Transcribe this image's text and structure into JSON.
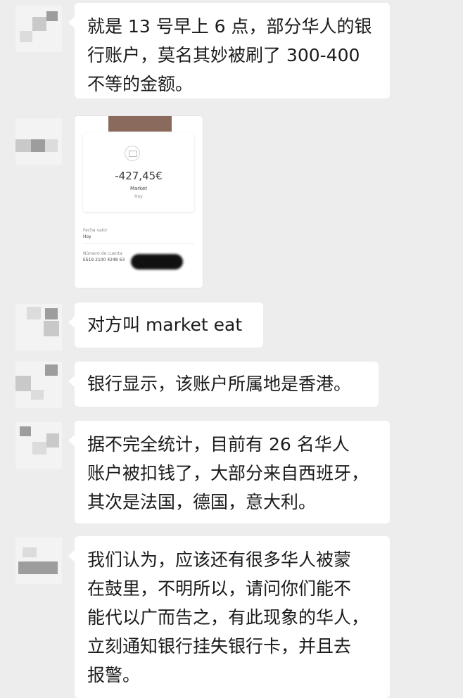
{
  "messages": [
    {
      "type": "text",
      "lines": [
        "就是 13 号早上 6 点，部分华人的银",
        "行账户，莫名其妙被刷了 300-400",
        "不等的金额。"
      ]
    },
    {
      "type": "image",
      "amount": "-427,45€",
      "merchant": "Market",
      "date": "Hoy",
      "field1_label": "Fecha valor",
      "field1_value": "Hoy",
      "field2_label": "Número de cuenta",
      "field2_value": "ES19 2100 4248 63"
    },
    {
      "type": "text",
      "lines": [
        "对方叫 market eat"
      ]
    },
    {
      "type": "text",
      "lines": [
        "银行显示，该账户所属地是香港。"
      ]
    },
    {
      "type": "text",
      "lines": [
        "据不完全统计，目前有 26 名华人",
        "账户被扣钱了，大部分来自西班牙，",
        "其次是法国，德国，意大利。"
      ]
    },
    {
      "type": "text",
      "lines": [
        "我们认为，应该还有很多华人被蒙",
        "在鼓里，不明所以，请问你们能不",
        "能代以广而告之，有此现象的华人，",
        "立刻通知银行挂失银行卡，并且去",
        "报警。"
      ]
    }
  ],
  "colors": {
    "background": "#ededed",
    "bubble": "#ffffff",
    "text": "#1b1b1b"
  }
}
